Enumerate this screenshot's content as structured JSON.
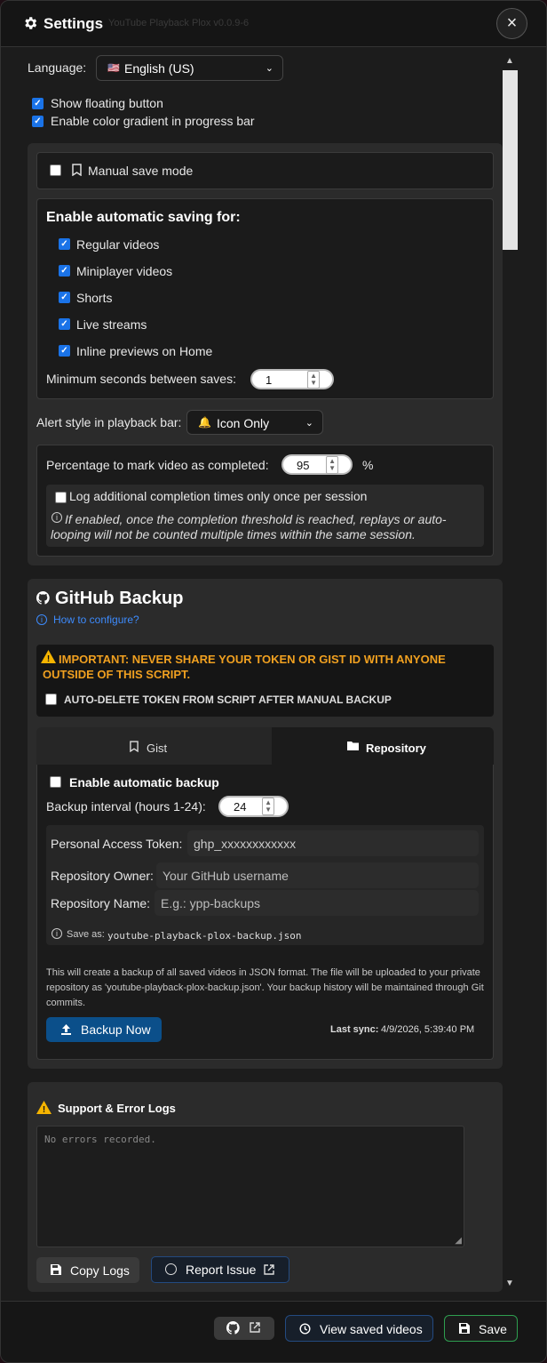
{
  "header": {
    "title": "Settings",
    "version": "YouTube Playback Plox v0.0.9-6",
    "close": "×"
  },
  "language": {
    "label": "Language:",
    "flag": "🇺🇸",
    "value": "English (US)"
  },
  "general": {
    "floating": "Show floating button",
    "gradient": "Enable color gradient in progress bar"
  },
  "manual": {
    "label": "Manual save mode"
  },
  "auto": {
    "title": "Enable automatic saving for:",
    "items": [
      "Regular videos",
      "Miniplayer videos",
      "Shorts",
      "Live streams",
      "Inline previews on Home"
    ],
    "min_label": "Minimum seconds between saves:",
    "min_value": "1"
  },
  "alert": {
    "label": "Alert style in playback bar:",
    "icon": "🔔",
    "value": "Icon Only"
  },
  "completion": {
    "label": "Percentage to mark video as completed:",
    "value": "95",
    "unit": "%",
    "log_label": "Log additional completion times only once per session",
    "info": "If enabled, once the completion threshold is reached, replays or auto-looping will not be counted multiple times within the same session."
  },
  "github": {
    "title": "GitHub Backup",
    "howto": "How to configure?",
    "warning": "IMPORTANT: NEVER SHARE YOUR TOKEN OR GIST ID WITH ANYONE OUTSIDE OF THIS SCRIPT.",
    "autodelete": "AUTO-DELETE TOKEN FROM SCRIPT AFTER MANUAL BACKUP",
    "tabs": [
      "Gist",
      "Repository"
    ],
    "active_tab": "Repository",
    "enable_auto": "Enable automatic backup",
    "interval_label": "Backup interval (hours 1-24):",
    "interval_value": "24",
    "token_label": "Personal Access Token:",
    "token_value": "ghp_xxxxxxxxxxxx",
    "owner_label": "Repository Owner:",
    "owner_placeholder": "Your GitHub username",
    "name_label": "Repository Name:",
    "name_placeholder": "E.g.: ypp-backups",
    "save_as_label": "Save as:",
    "save_as_file": "youtube-playback-plox-backup.json",
    "description": "This will create a backup of all saved videos in JSON format. The file will be uploaded to your private repository as 'youtube-playback-plox-backup.json'. Your backup history will be maintained through Git commits.",
    "backup_now": "Backup Now",
    "last_sync_label": "Last sync:",
    "last_sync_value": "4/9/2026, 5:39:40 PM"
  },
  "logs": {
    "title": "Support & Error Logs",
    "placeholder": "No errors recorded.",
    "copy": "Copy Logs",
    "report": "Report Issue"
  },
  "footer": {
    "view_saved": "View saved videos",
    "save": "Save"
  },
  "colors": {
    "accent": "#1a73e8",
    "warning": "#f0a020",
    "backup_btn": "#0b4f8a",
    "save_border": "#2e9e4f"
  }
}
